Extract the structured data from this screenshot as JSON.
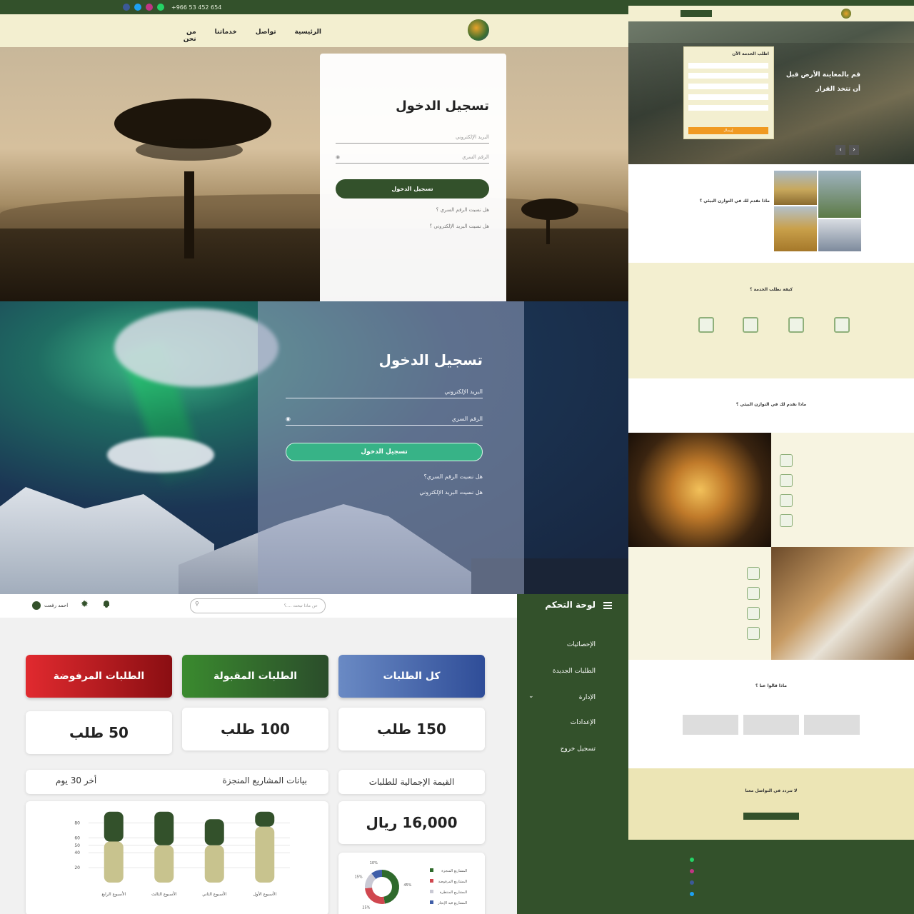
{
  "login_savanna": {
    "phone": "+966 53 452 654",
    "nav": [
      "الرئيسية",
      "تواصل",
      "خدماتنا",
      "من نحن"
    ],
    "title": "تسجيل الدخول",
    "email_placeholder": "البريد الإلكتروني",
    "password_placeholder": "الرقم السري",
    "submit": "تسجيل الدخول",
    "forgot_password": "هل نسيت الرقم السري ؟",
    "forgot_email": "هل نسيت البريد الإلكتروني ؟"
  },
  "login_aurora": {
    "title": "تسجيل الدخول",
    "email_placeholder": "البريد الإلكتروني",
    "password_placeholder": "الرقم السري",
    "submit": "تسجيل الدخول",
    "forgot_password": "هل نسيت الرقم السري؟",
    "forgot_email": "هل نسيت البريد الإلكتروني"
  },
  "landing": {
    "hero_title_1": "قم بالمعاينة الأرض قبل",
    "hero_title_2": "أن تتخذ القرار",
    "form_title": "اطلب الخدمة الآن",
    "form_submit": "إرسال",
    "about_title": "ماذا نقدم لك في التوازن البيئي ؟",
    "how_title": "كيفة نطلب الخدمة ؟",
    "offer_title": "ماذا نقدم لك في التوازن البيئي ؟",
    "testimonials_title": "ماذا قالوا عنا ؟",
    "contact_title": "لا تتردد في التواصل معنا"
  },
  "dashboard": {
    "sidebar_title": "لوحة التحكم",
    "sidebar_items": [
      "الإحصائيات",
      "الطلبات الجديدة",
      "الإدارة",
      "الإعدادات",
      "تسجيل خروج"
    ],
    "search_placeholder": "عن ماذا تبحث ....؟",
    "user_name": "احمد رفعت",
    "cards": [
      {
        "label": "كل الطلبات",
        "value": "150 طلب",
        "color": "#3f5ea8"
      },
      {
        "label": "الطلبات المقبولة",
        "value": "100 طلب",
        "color": "#2f6a2c"
      },
      {
        "label": "الطلبات المرفوضة",
        "value": "50 طلب",
        "color": "#b0141a"
      }
    ],
    "total_label": "القيمة الإجمالية للطلبات",
    "total_value": "16,000 ريال",
    "projects_label": "بيانات  المشاريع المنجزة",
    "period_label": "أخر 30 يوم"
  },
  "chart_data": [
    {
      "type": "bar",
      "categories": [
        "الأسبوع الأول",
        "الأسبوع الثاني",
        "الأسبوع الثالث",
        "الأسبوع الرابع"
      ],
      "series": [
        {
          "values": [
            75,
            50,
            50,
            55
          ]
        },
        {
          "values": [
            20,
            35,
            45,
            40
          ]
        }
      ],
      "yticks": [
        20,
        40,
        50,
        60,
        80
      ],
      "ylim": [
        0,
        90
      ],
      "colors": [
        "#c8c38e",
        "#33512b"
      ]
    },
    {
      "type": "pie",
      "labels": [
        "المشاريع المنجزة",
        "المشاريع المرفوضة",
        "المشاريع المنتظرة",
        "المشاريع قيد الإنجاز"
      ],
      "values": [
        45,
        25,
        15,
        10
      ],
      "value_labels": [
        "45%",
        "25%",
        "15%",
        "10%"
      ],
      "colors": [
        "#2f6a2c",
        "#d0474f",
        "#c9c9d4",
        "#3f5ea8"
      ]
    }
  ]
}
